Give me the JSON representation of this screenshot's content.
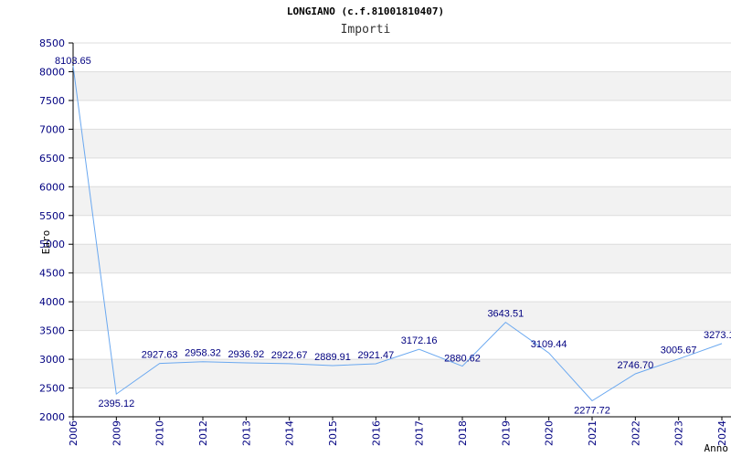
{
  "chart_data": {
    "type": "line",
    "title": "LONGIANO (c.f.81001810407)",
    "subtitle": "Importi",
    "xlabel": "Anno",
    "ylabel": "Euro",
    "ylim": [
      2000,
      8500
    ],
    "yticks": [
      2000,
      2500,
      3000,
      3500,
      4000,
      4500,
      5000,
      5500,
      6000,
      6500,
      7000,
      7500,
      8000,
      8500
    ],
    "x": [
      "2006",
      "2009",
      "2010",
      "2012",
      "2013",
      "2014",
      "2015",
      "2016",
      "2017",
      "2018",
      "2019",
      "2020",
      "2021",
      "2022",
      "2023",
      "2024"
    ],
    "series": [
      {
        "values": [
          8103.65,
          2395.12,
          2927.63,
          2958.32,
          2936.92,
          2922.67,
          2889.91,
          2921.47,
          3172.16,
          2880.62,
          3643.51,
          3109.44,
          2277.72,
          2746.7,
          3005.67,
          3273.17
        ],
        "labels": [
          "8103.65",
          "2395.12",
          "2927.63",
          "2958.32",
          "2936.92",
          "2922.67",
          "2889.91",
          "2921.47",
          "3172.16",
          "2880.62",
          "3643.51",
          "3109.44",
          "2277.72",
          "2746.70",
          "3005.67",
          "3273.1"
        ]
      }
    ],
    "grid": true,
    "colors": {
      "line": "#6aa8f0",
      "band": "#f2f2f2",
      "gridline": "#dddddd",
      "tick_text": "#000080"
    }
  }
}
